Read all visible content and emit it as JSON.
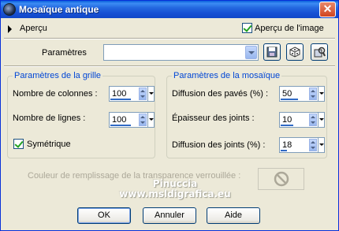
{
  "window": {
    "title": "Mosaïque antique",
    "close_symbol": "✕"
  },
  "preview": {
    "label": "Aperçu",
    "image_preview_label": "Aperçu de l'image",
    "image_preview_checked": true
  },
  "presets": {
    "label": "Paramètres",
    "value": ""
  },
  "grid": {
    "title": "Paramètres de la grille",
    "columns_label": "Nombre de colonnes :",
    "columns_value": "100",
    "rows_label": "Nombre de lignes :",
    "rows_value": "100",
    "symmetric_label": "Symétrique",
    "symmetric_checked": true
  },
  "mosaic": {
    "title": "Paramètres de la mosaïque",
    "tile_diffusion_label": "Diffusion des pavés (%) :",
    "tile_diffusion_value": "50",
    "joint_thickness_label": "Épaisseur des joints :",
    "joint_thickness_value": "10",
    "joint_diffusion_label": "Diffusion des joints (%) :",
    "joint_diffusion_value": "18"
  },
  "fill": {
    "label": "Couleur de remplissage de la transparence verrouillée :"
  },
  "watermark": {
    "line1": "Pinuccia",
    "line2": "www.msldigrafica.eu"
  },
  "buttons": {
    "ok": "OK",
    "cancel": "Annuler",
    "help": "Aide"
  },
  "colors": {
    "titlebar": "#0a5fdc",
    "accent": "#0046d5",
    "window_bg": "#ece9d8"
  }
}
